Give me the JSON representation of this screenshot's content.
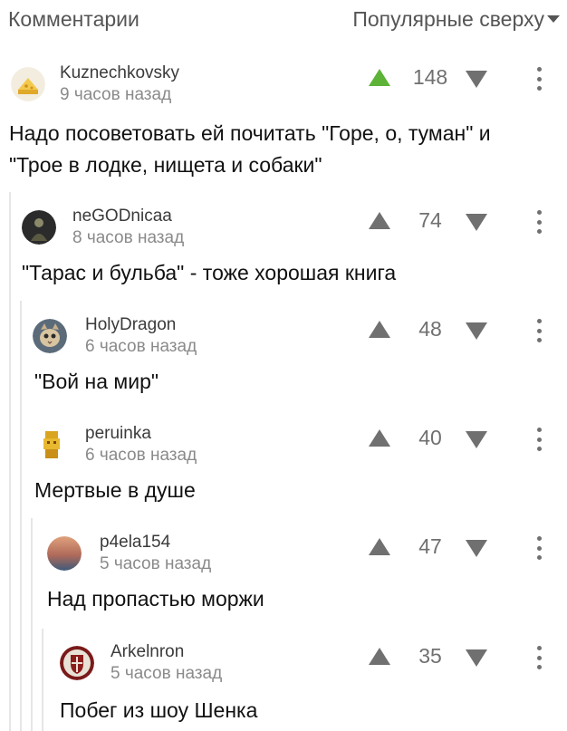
{
  "header": {
    "title": "Комментарии",
    "sort_label": "Популярные сверху"
  },
  "comments": [
    {
      "username": "Kuznechkovsky",
      "time": "9 часов назад",
      "rating": "148",
      "upvoted": true,
      "text": "Надо посоветовать ей почитать \"Горе, о, туман\" и \"Трое в лодке, нищета и собаки\"",
      "avatar_icon": "cheese-icon"
    },
    {
      "username": "neGODnicaa",
      "time": "8 часов назад",
      "rating": "74",
      "upvoted": false,
      "text": "\"Тарас и бульба\" - тоже хорошая книга",
      "avatar_icon": "dark-figure-icon"
    },
    {
      "username": "HolyDragon",
      "time": "6 часов назад",
      "rating": "48",
      "upvoted": false,
      "text": "\"Вой на мир\"",
      "avatar_icon": "cat-icon"
    },
    {
      "username": "peruinka",
      "time": "6 часов назад",
      "rating": "40",
      "upvoted": false,
      "text": "Мертвые в душе",
      "avatar_icon": "golden-idol-icon"
    },
    {
      "username": "p4ela154",
      "time": "5 часов назад",
      "rating": "47",
      "upvoted": false,
      "text": "Над пропастью моржи",
      "avatar_icon": "sunset-icon"
    },
    {
      "username": "Arkelnron",
      "time": "5 часов назад",
      "rating": "35",
      "upvoted": false,
      "text": "Побег из шоу Шенка",
      "avatar_icon": "shield-icon"
    }
  ],
  "colors": {
    "upvote_active": "#5cb338",
    "icon_gray": "#707070",
    "thread_line": "#e6e6e6"
  }
}
